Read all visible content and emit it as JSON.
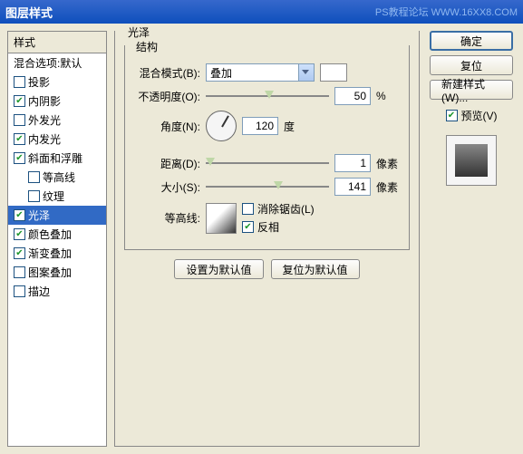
{
  "window": {
    "title": "图层样式",
    "watermark": "PS教程论坛 WWW.16XX8.COM"
  },
  "sidebar": {
    "header": "样式",
    "blend_defaults": "混合选项:默认",
    "items": [
      {
        "label": "投影",
        "checked": false
      },
      {
        "label": "内阴影",
        "checked": true
      },
      {
        "label": "外发光",
        "checked": false
      },
      {
        "label": "内发光",
        "checked": true
      },
      {
        "label": "斜面和浮雕",
        "checked": true
      },
      {
        "label": "等高线",
        "checked": false,
        "indent": true
      },
      {
        "label": "纹理",
        "checked": false,
        "indent": true
      },
      {
        "label": "光泽",
        "checked": true,
        "selected": true
      },
      {
        "label": "颜色叠加",
        "checked": true
      },
      {
        "label": "渐变叠加",
        "checked": true
      },
      {
        "label": "图案叠加",
        "checked": false
      },
      {
        "label": "描边",
        "checked": false
      }
    ]
  },
  "center": {
    "title": "光泽",
    "struct": "结构",
    "blend_mode_label": "混合模式(B):",
    "blend_mode_value": "叠加",
    "opacity_label": "不透明度(O):",
    "opacity_value": "50",
    "opacity_unit": "%",
    "angle_label": "角度(N):",
    "angle_value": "120",
    "angle_unit": "度",
    "distance_label": "距离(D):",
    "distance_value": "1",
    "distance_unit": "像素",
    "size_label": "大小(S):",
    "size_value": "141",
    "size_unit": "像素",
    "contour_label": "等高线:",
    "antialias_label": "消除锯齿(L)",
    "invert_label": "反相",
    "set_default": "设置为默认值",
    "reset_default": "复位为默认值"
  },
  "right": {
    "ok": "确定",
    "cancel": "复位",
    "new_style": "新建样式(W)...",
    "preview": "预览(V)"
  }
}
